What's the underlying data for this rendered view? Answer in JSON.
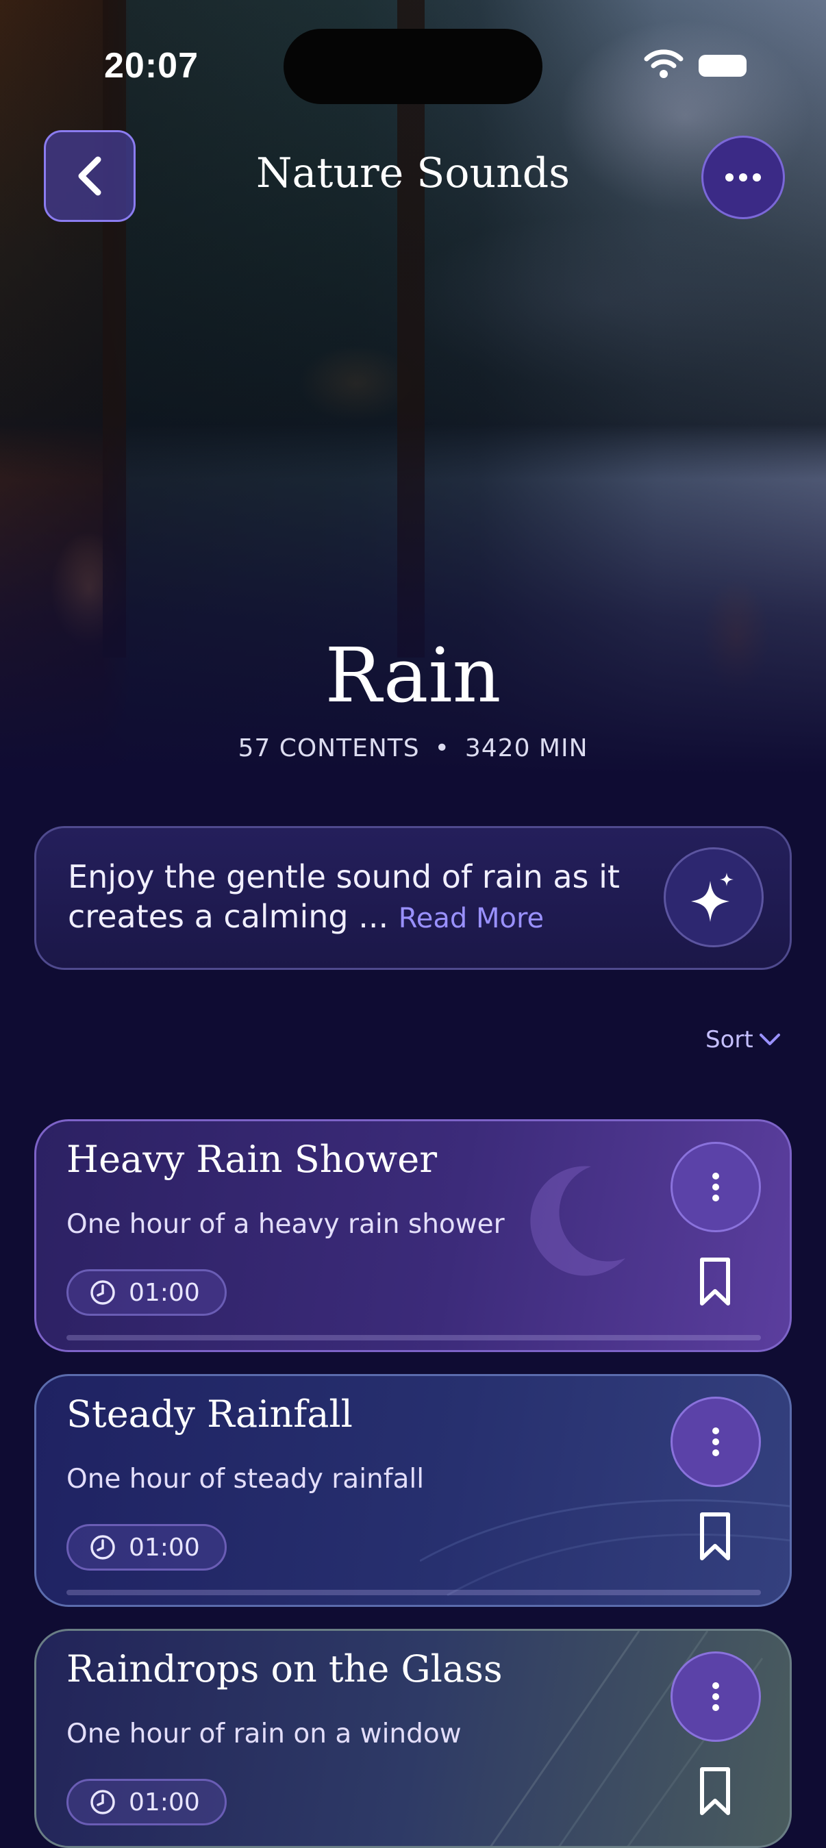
{
  "status_bar": {
    "time": "20:07"
  },
  "header": {
    "title": "Nature Sounds"
  },
  "hero": {
    "title": "Rain",
    "contents_count": "57 CONTENTS",
    "separator": "•",
    "duration_total": "3420 MIN"
  },
  "description": {
    "text": "Enjoy the gentle sound of rain as it creates a calming ...",
    "read_more": "Read More"
  },
  "sort": {
    "label": "Sort"
  },
  "tracks": [
    {
      "title": "Heavy Rain Shower",
      "subtitle": "One hour of a heavy rain shower",
      "duration": "01:00"
    },
    {
      "title": "Steady Rainfall",
      "subtitle": "One hour of steady rainfall",
      "duration": "01:00"
    },
    {
      "title": "Raindrops on the Glass",
      "subtitle": "One hour of rain on a window",
      "duration": "01:00"
    }
  ],
  "colors": {
    "background": "#0f0c33",
    "accent": "#8b7cf0",
    "link": "#9a91ff"
  }
}
